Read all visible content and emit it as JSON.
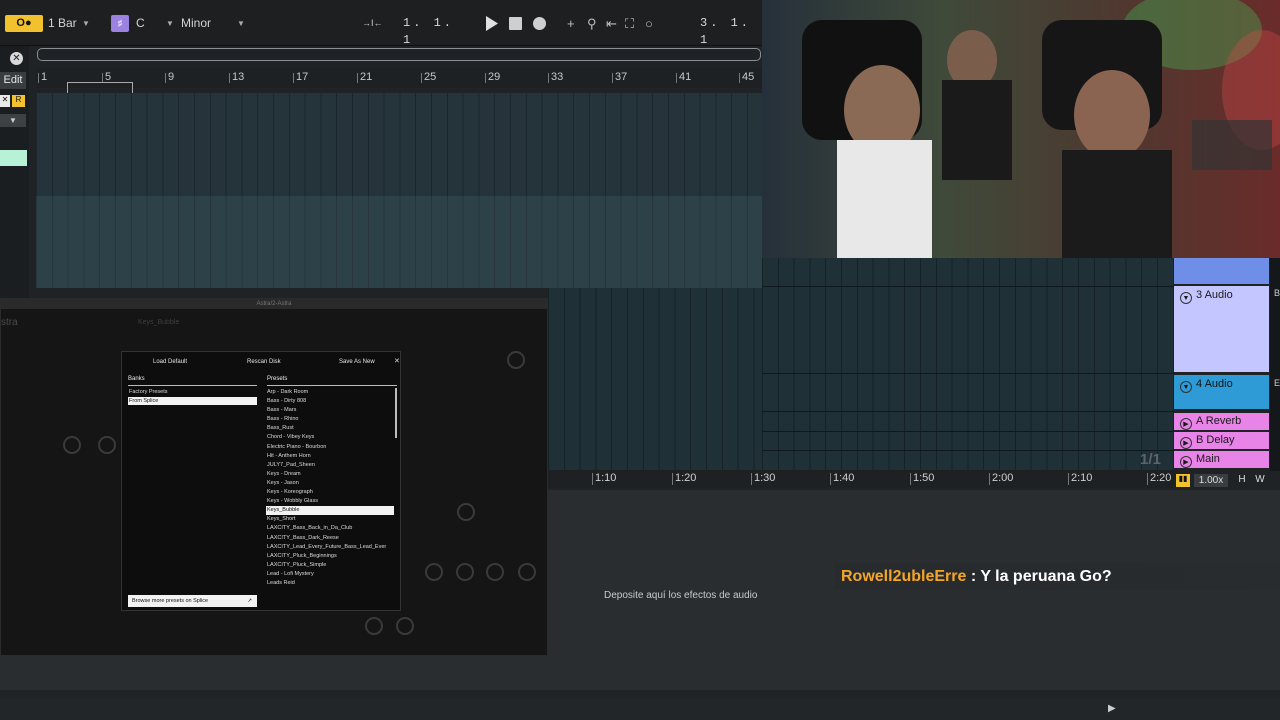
{
  "transport": {
    "quantize_button": "O●",
    "quantize_value": "1 Bar",
    "key_icon": "♯",
    "key_value": "C",
    "scale_value": "Minor",
    "follow_icon": "→I←",
    "position": "1.  1.  1",
    "loop_position": "3.  1.  1",
    "icons": {
      "play": "play-icon",
      "stop": "stop-icon",
      "record": "record-icon",
      "add": "+",
      "link": "⚲",
      "back": "⇤",
      "punch": "⛶",
      "circle": "○"
    }
  },
  "left_strip": {
    "close": "✕",
    "edit": "Edit",
    "x": "✕",
    "r": "R",
    "v": "▼"
  },
  "ruler": {
    "bars": [
      "1",
      "5",
      "9",
      "13",
      "17",
      "21",
      "25",
      "29",
      "33",
      "37",
      "41",
      "45"
    ]
  },
  "tracks": [
    {
      "label": "3 Audio",
      "circle": "▼"
    },
    {
      "label": "4 Audio",
      "circle": "▼"
    },
    {
      "label": "A Reverb",
      "circle": "▶"
    },
    {
      "label": "B Delay",
      "circle": "▶"
    },
    {
      "label": "Main",
      "circle": "▶"
    }
  ],
  "track_side_letters": [
    "B",
    "E"
  ],
  "fraction": "1/1",
  "time_ruler": {
    "ticks": [
      "1:10",
      "1:20",
      "1:30",
      "1:40",
      "1:50",
      "2:00",
      "2:10",
      "2:20"
    ],
    "zoom": "1.00x",
    "h": "H",
    "w": "W"
  },
  "device_area": {
    "drop_hint": "Deposite aquí los efectos de audio"
  },
  "chat": {
    "user": "Rowell2ubleErre",
    "separator": " : ",
    "message": "Y la peruana Go?"
  },
  "plugin": {
    "title": "Astra/2-Astra",
    "preset_name": "Keys_Bubble",
    "browser": {
      "load_default": "Load Default",
      "rescan_disk": "Rescan Disk",
      "save_as_new": "Save As New",
      "close": "✕",
      "banks_title": "Banks",
      "presets_title": "Presets",
      "banks": [
        "Factory Presets",
        "From Splice"
      ],
      "presets": [
        "Arp - Dark Room",
        "Bass - Dirty 808",
        "Bass - Mars",
        "Bass - Rhino",
        "Bass_Rust",
        "Chord - Vibey Keys",
        "Electric Piano - Bourbon",
        "Hit - Anthem Horn",
        "JULY7_Pad_Sheen",
        "Keys - Dream",
        "Keys - Jason",
        "Keys - Koreograph",
        "Keys - Wobbly Glass",
        "Keys_Bubble",
        "Keys_Short",
        "LAXCITY_Bass_Back_in_Da_Club",
        "LAXCITY_Bass_Dark_Reese",
        "LAXCITY_Lead_Every_Future_Bass_Lead_Ever",
        "LAXCITY_Pluck_Beginnings",
        "LAXCITY_Pluck_Simple",
        "Lead - Lofi Mystery",
        "Leads Reid"
      ],
      "browse_more": "Browse more presets on Splice",
      "browse_arrow": "↗"
    }
  }
}
